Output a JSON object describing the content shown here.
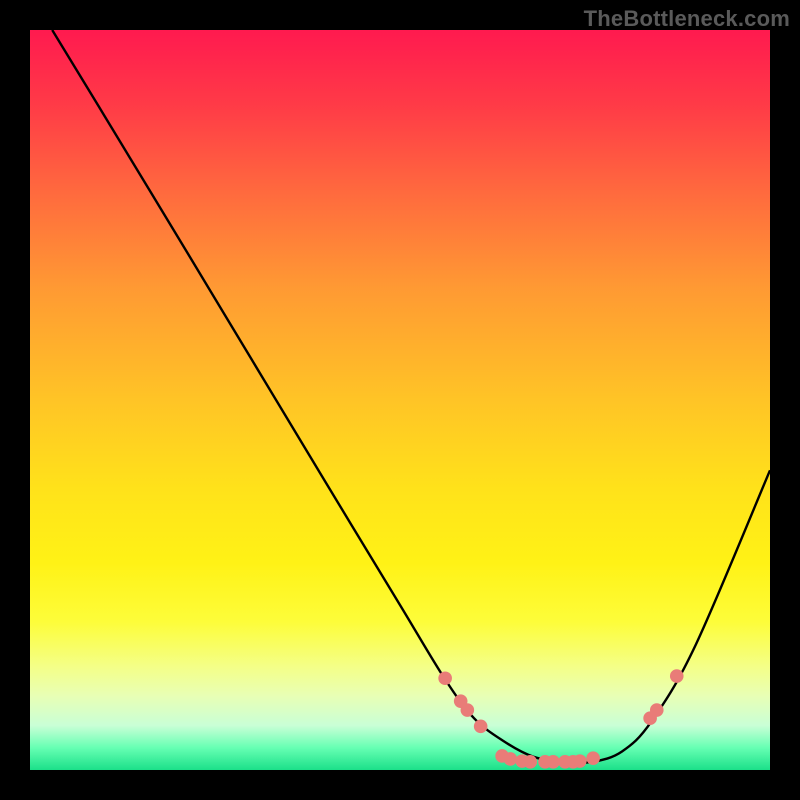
{
  "watermark": "TheBottleneck.com",
  "colors": {
    "dot": "#e97c78",
    "line": "#000000",
    "frame": "#000000"
  },
  "chart_data": {
    "type": "line",
    "title": "",
    "xlabel": "",
    "ylabel": "",
    "xlim": [
      0,
      100
    ],
    "ylim": [
      0,
      100
    ],
    "note": "Values estimated from pixel positions; no axes/ticks are shown in the image.",
    "series": [
      {
        "name": "curve",
        "x": [
          3,
          10,
          20,
          30,
          40,
          50,
          56,
          60,
          64,
          68,
          72,
          76,
          80,
          84,
          90,
          100
        ],
        "y": [
          100,
          88.5,
          72,
          55.4,
          38.8,
          22.3,
          12.4,
          7.0,
          3.9,
          1.8,
          1.1,
          1.1,
          2.5,
          6.6,
          17.0,
          40.5
        ]
      }
    ],
    "scatter_points": [
      {
        "x": 56.1,
        "y": 12.4
      },
      {
        "x": 58.2,
        "y": 9.3
      },
      {
        "x": 59.1,
        "y": 8.1
      },
      {
        "x": 60.9,
        "y": 5.9
      },
      {
        "x": 63.8,
        "y": 1.9
      },
      {
        "x": 64.9,
        "y": 1.5
      },
      {
        "x": 66.5,
        "y": 1.2
      },
      {
        "x": 67.6,
        "y": 1.1
      },
      {
        "x": 69.6,
        "y": 1.1
      },
      {
        "x": 70.7,
        "y": 1.1
      },
      {
        "x": 72.3,
        "y": 1.1
      },
      {
        "x": 73.4,
        "y": 1.1
      },
      {
        "x": 74.3,
        "y": 1.2
      },
      {
        "x": 76.1,
        "y": 1.6
      },
      {
        "x": 83.8,
        "y": 7.0
      },
      {
        "x": 84.7,
        "y": 8.1
      },
      {
        "x": 87.4,
        "y": 12.7
      }
    ]
  }
}
